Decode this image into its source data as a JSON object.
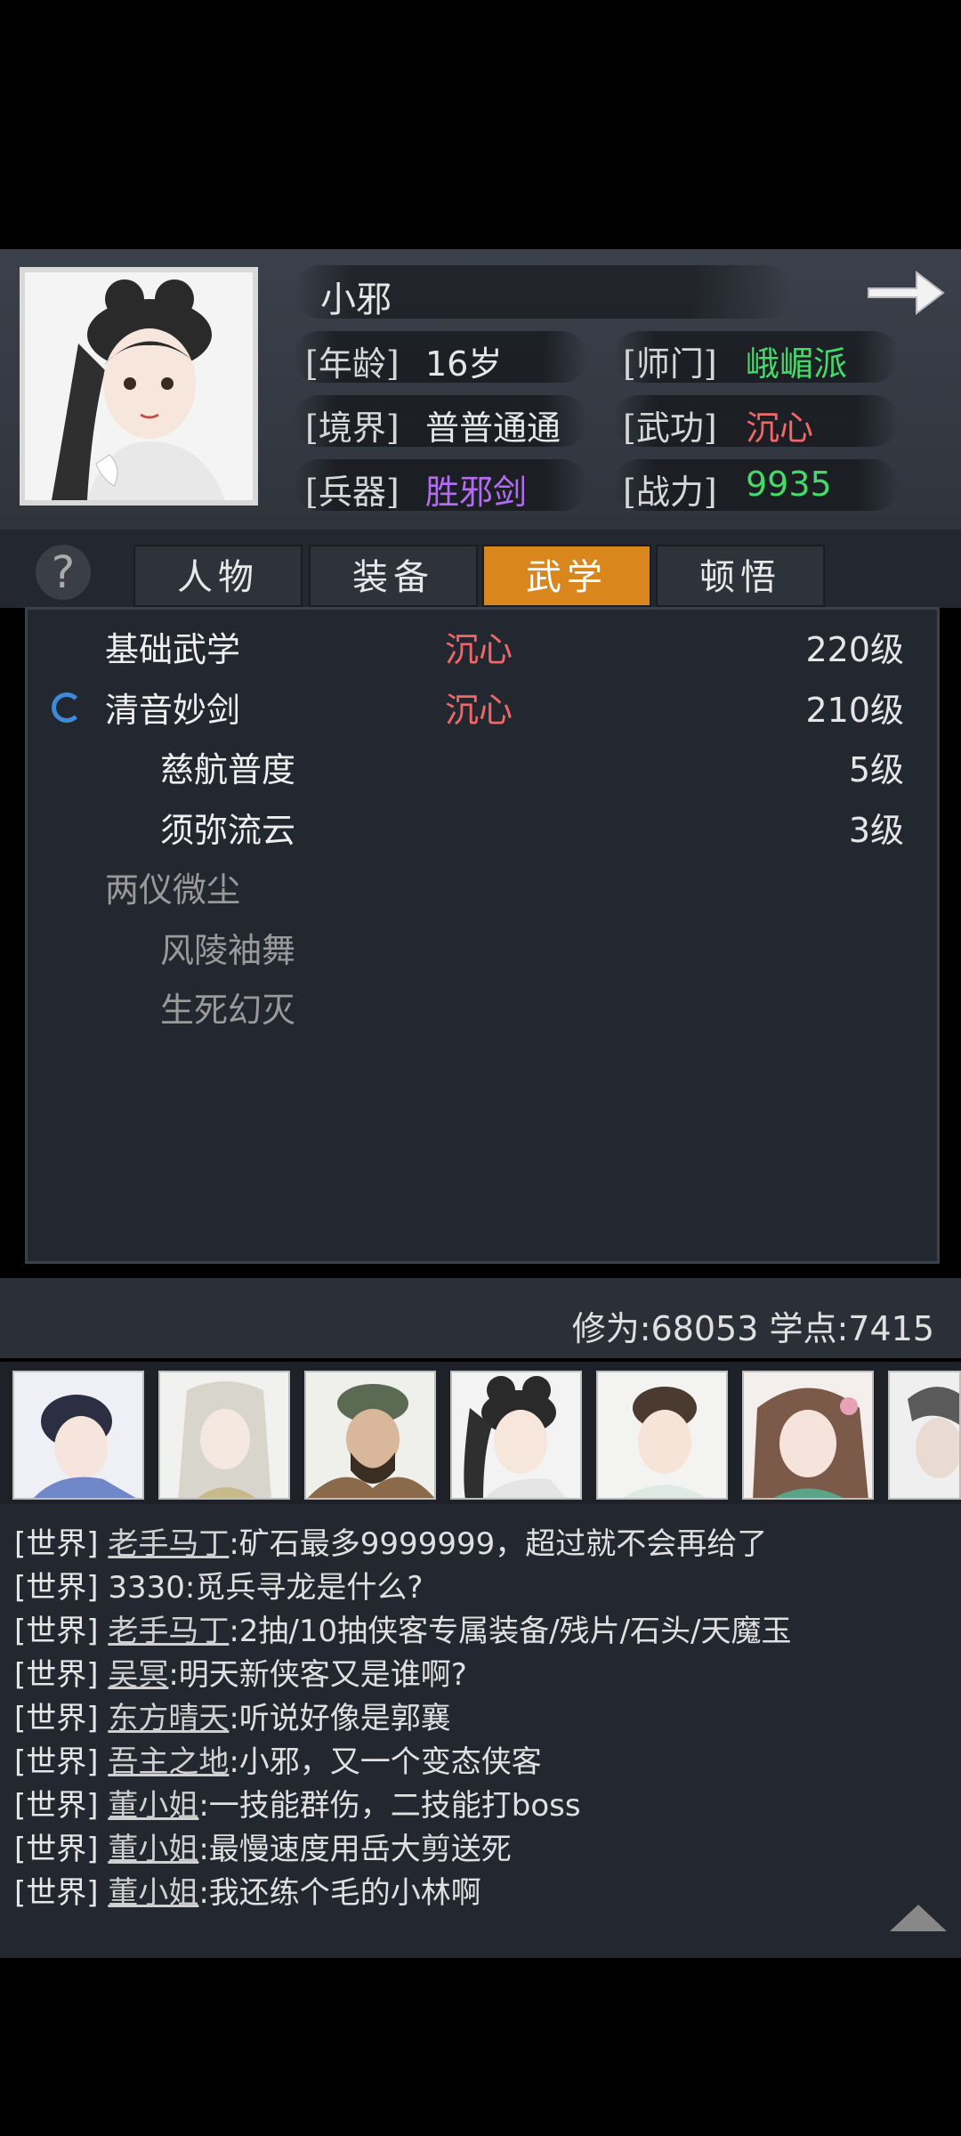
{
  "character": {
    "name": "小邪",
    "age_label": "[年龄]",
    "age": "16岁",
    "school_label": "[师门]",
    "school": "峨嵋派",
    "realm_label": "[境界]",
    "realm": "普普通通",
    "martial_label": "[武功]",
    "martial": "沉心",
    "weapon_label": "[兵器]",
    "weapon": "胜邪剑",
    "power_label": "[战力]",
    "power": "9935"
  },
  "tabs": [
    {
      "label": "人物"
    },
    {
      "label": "装备"
    },
    {
      "label": "武学",
      "active": true
    },
    {
      "label": "顿悟"
    }
  ],
  "skills": [
    {
      "name": "基础武学",
      "style": "沉心",
      "level": "220级"
    },
    {
      "name": "清音妙剑",
      "style": "沉心",
      "level": "210级"
    },
    {
      "name": "慈航普度",
      "style": "",
      "level": "5级"
    },
    {
      "name": "须弥流云",
      "style": "",
      "level": "3级"
    },
    {
      "name": "两仪微尘",
      "style": "",
      "level": ""
    },
    {
      "name": "风陵袖舞",
      "style": "",
      "level": ""
    },
    {
      "name": "生死幻灭",
      "style": "",
      "level": ""
    }
  ],
  "stats": {
    "text": "修为:68053  学点:7415"
  },
  "chat": [
    {
      "channel": "[世界]",
      "nick": "老手马丁",
      "msg": ":矿石最多9999999，超过就不会再给了"
    },
    {
      "channel": "[世界]",
      "nick": "",
      "msg": "3330:觅兵寻龙是什么?"
    },
    {
      "channel": "[世界]",
      "nick": "老手马丁",
      "msg": ":2抽/10抽侠客专属装备/残片/石头/天魔玉"
    },
    {
      "channel": "[世界]",
      "nick": "吴冥",
      "msg": ":明天新侠客又是谁啊?"
    },
    {
      "channel": "[世界]",
      "nick": "东方晴天",
      "msg": ":听说好像是郭襄"
    },
    {
      "channel": "[世界]",
      "nick": "吾主之地",
      "msg": ":小邪，又一个变态侠客"
    },
    {
      "channel": "[世界]",
      "nick": "董小姐",
      "msg": ":一技能群伤，二技能打boss"
    },
    {
      "channel": "[世界]",
      "nick": "董小姐",
      "msg": ":最慢速度用岳大剪送死"
    },
    {
      "channel": "[世界]",
      "nick": "董小姐",
      "msg": ":我还练个毛的小林啊"
    }
  ],
  "colors": {
    "school": "#46d96a",
    "martial": "#f06767",
    "weapon": "#b36bf0",
    "power": "#46d96a",
    "tab_active": "#d9861c"
  }
}
